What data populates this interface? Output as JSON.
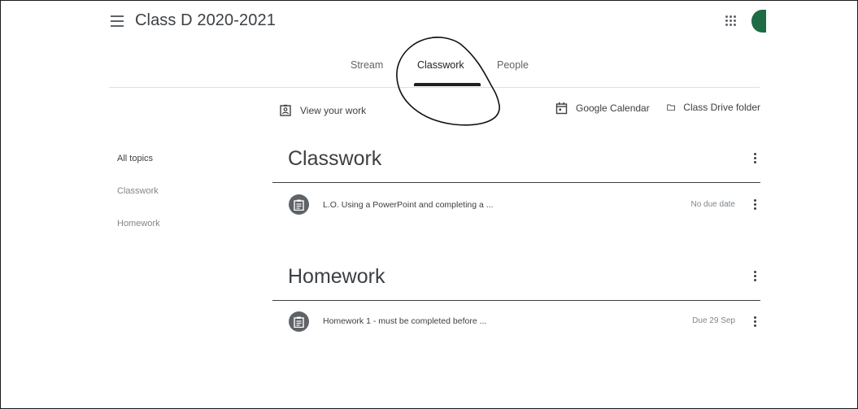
{
  "header": {
    "menu_icon": "hamburger-menu-icon",
    "class_title": "Class D 2020-2021",
    "apps_icon": "google-apps-grid-icon",
    "avatar_color": "#1e6b45"
  },
  "tabs": [
    {
      "label": "Stream",
      "active": false
    },
    {
      "label": "Classwork",
      "active": true
    },
    {
      "label": "People",
      "active": false
    }
  ],
  "toolbar": {
    "view_work": {
      "label": "View your work",
      "icon": "assignment-ind-icon"
    },
    "calendar": {
      "label": "Google Calendar",
      "icon": "calendar-icon"
    },
    "drive": {
      "label": "Class Drive folder",
      "icon": "folder-icon"
    }
  },
  "sidebar": {
    "items": [
      {
        "label": "All topics",
        "selected": true
      },
      {
        "label": "Classwork",
        "selected": false
      },
      {
        "label": "Homework",
        "selected": false
      }
    ]
  },
  "sections": [
    {
      "title": "Classwork",
      "items": [
        {
          "title": "L.O. Using a PowerPoint and completing a ...",
          "due": "No due date",
          "icon": "assignment-icon"
        }
      ]
    },
    {
      "title": "Homework",
      "items": [
        {
          "title": "Homework 1 - must be completed before ...",
          "due": "Due 29 Sep",
          "icon": "assignment-icon"
        }
      ]
    }
  ],
  "colors": {
    "text_primary": "#3c4043",
    "text_secondary": "#80868b",
    "icon_circle": "#5f6368",
    "divider": "#e0e0e0"
  }
}
